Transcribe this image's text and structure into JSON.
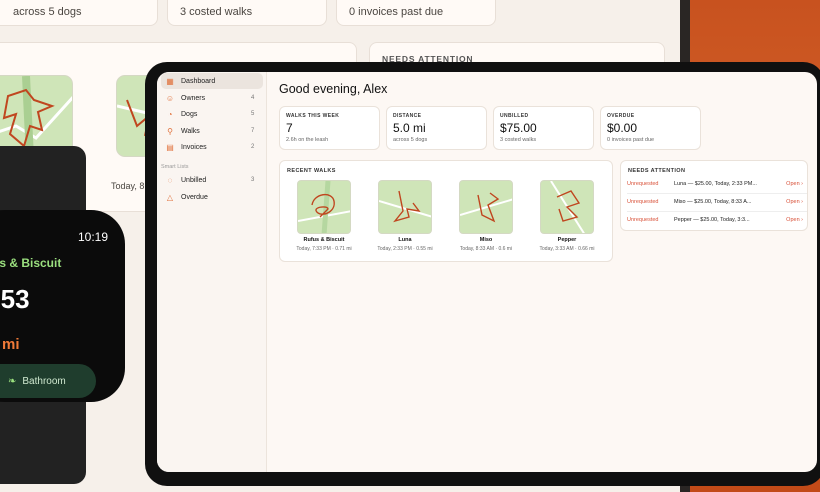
{
  "laptop": {
    "stat_subs": [
      "across 5 dogs",
      "3 costed walks",
      "0 invoices past due"
    ],
    "needs_attention_title": "NEEDS ATTENTION",
    "walk_date": "Today, 8"
  },
  "watch": {
    "time": "10:19",
    "walk_name": "us & Biscuit",
    "timer": ":53",
    "distance_unit": "mi",
    "action_label": "Bathroom"
  },
  "tablet": {
    "sidebar": {
      "items": [
        {
          "label": "Dashboard",
          "icon": "dashboard-icon",
          "glyph": "▦",
          "count": ""
        },
        {
          "label": "Owners",
          "icon": "owners-icon",
          "glyph": "☺",
          "count": "4"
        },
        {
          "label": "Dogs",
          "icon": "dogs-icon",
          "glyph": "◔",
          "count": "5"
        },
        {
          "label": "Walks",
          "icon": "walks-icon",
          "glyph": "⚲",
          "count": "7"
        },
        {
          "label": "Invoices",
          "icon": "invoices-icon",
          "glyph": "▤",
          "count": "2"
        }
      ],
      "smart_lists_heading": "Smart Lists",
      "smart_lists": [
        {
          "label": "Unbilled",
          "icon": "unbilled-icon",
          "glyph": "◌",
          "count": "3"
        },
        {
          "label": "Overdue",
          "icon": "overdue-icon",
          "glyph": "△",
          "count": ""
        }
      ]
    },
    "greeting": "Good evening, Alex",
    "stats": [
      {
        "title": "WALKS THIS WEEK",
        "value": "7",
        "sub": "2.6h on the leash"
      },
      {
        "title": "DISTANCE",
        "value": "5.0 mi",
        "sub": "across 5 dogs"
      },
      {
        "title": "UNBILLED",
        "value": "$75.00",
        "sub": "3 costed walks"
      },
      {
        "title": "OVERDUE",
        "value": "$0.00",
        "sub": "0 invoices past due"
      }
    ],
    "recent_walks_title": "RECENT WALKS",
    "recent_walks": [
      {
        "name": "Rufus & Biscuit",
        "detail": "Today, 7:33 PM · 0.71 mi"
      },
      {
        "name": "Luna",
        "detail": "Today, 2:33 PM · 0.55 mi"
      },
      {
        "name": "Miso",
        "detail": "Today, 8:33 AM · 0.6 mi"
      },
      {
        "name": "Pepper",
        "detail": "Today, 3:33 AM · 0.66 mi"
      }
    ],
    "needs_attention_title": "NEEDS ATTENTION",
    "attention": [
      {
        "tag": "Unrequested",
        "text": "Luna — $25.00, Today, 2:33 PM...",
        "action": "Open ›"
      },
      {
        "tag": "Unrequested",
        "text": "Miso — $25.00, Today, 8:33 A...",
        "action": "Open ›"
      },
      {
        "tag": "Unrequested",
        "text": "Pepper — $25.00, Today, 3:3...",
        "action": "Open ›"
      }
    ],
    "colors": {
      "accent": "#e0703a",
      "alert": "#d9523a",
      "route": "#c0461f"
    }
  }
}
